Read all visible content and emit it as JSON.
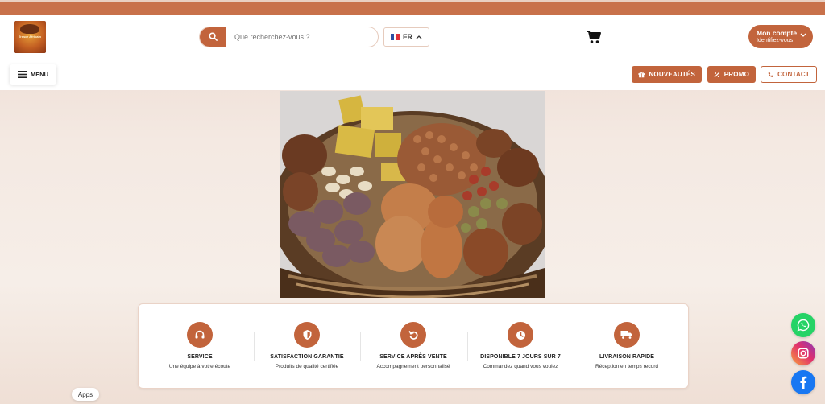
{
  "colors": {
    "accent": "#c2643c",
    "top_bar": "#c8714a",
    "whatsapp": "#25d366",
    "instagram": "#e1306c",
    "facebook": "#1877f2"
  },
  "header": {
    "logo_text": "Tresor Afrikain",
    "search": {
      "placeholder": "Que recherchez-vous ?",
      "icon": "search-icon"
    },
    "language": {
      "code": "FR",
      "flag": "france-flag-icon"
    },
    "cart_icon": "cart-icon",
    "account": {
      "title": "Mon compte",
      "subtitle": "Identifiez-vous"
    }
  },
  "nav": {
    "menu_label": "MENU",
    "buttons": [
      {
        "label": "NOUVEAUTÉS",
        "icon": "gift-icon"
      },
      {
        "label": "PROMO",
        "icon": "percent-icon"
      },
      {
        "label": "CONTACT",
        "icon": "phone-icon"
      }
    ]
  },
  "hero": {
    "alt_icon": "basket-photo"
  },
  "features": [
    {
      "title": "SERVICE",
      "subtitle": "Une équipe à votre écoute",
      "icon": "headset-icon"
    },
    {
      "title": "SATISFACTION GARANTIE",
      "subtitle": "Produits de qualité certifiée",
      "icon": "shield-icon"
    },
    {
      "title": "SERVICE APRÈS VENTE",
      "subtitle": "Accompagnement personnalisé",
      "icon": "undo-icon"
    },
    {
      "title": "DISPONIBLE 7 JOURS SUR 7",
      "subtitle": "Commandez quand vous voulez",
      "icon": "clock-icon"
    },
    {
      "title": "LIVRAISON RAPIDE",
      "subtitle": "Réception en temps record",
      "icon": "truck-icon"
    }
  ],
  "apps_label": "Apps"
}
